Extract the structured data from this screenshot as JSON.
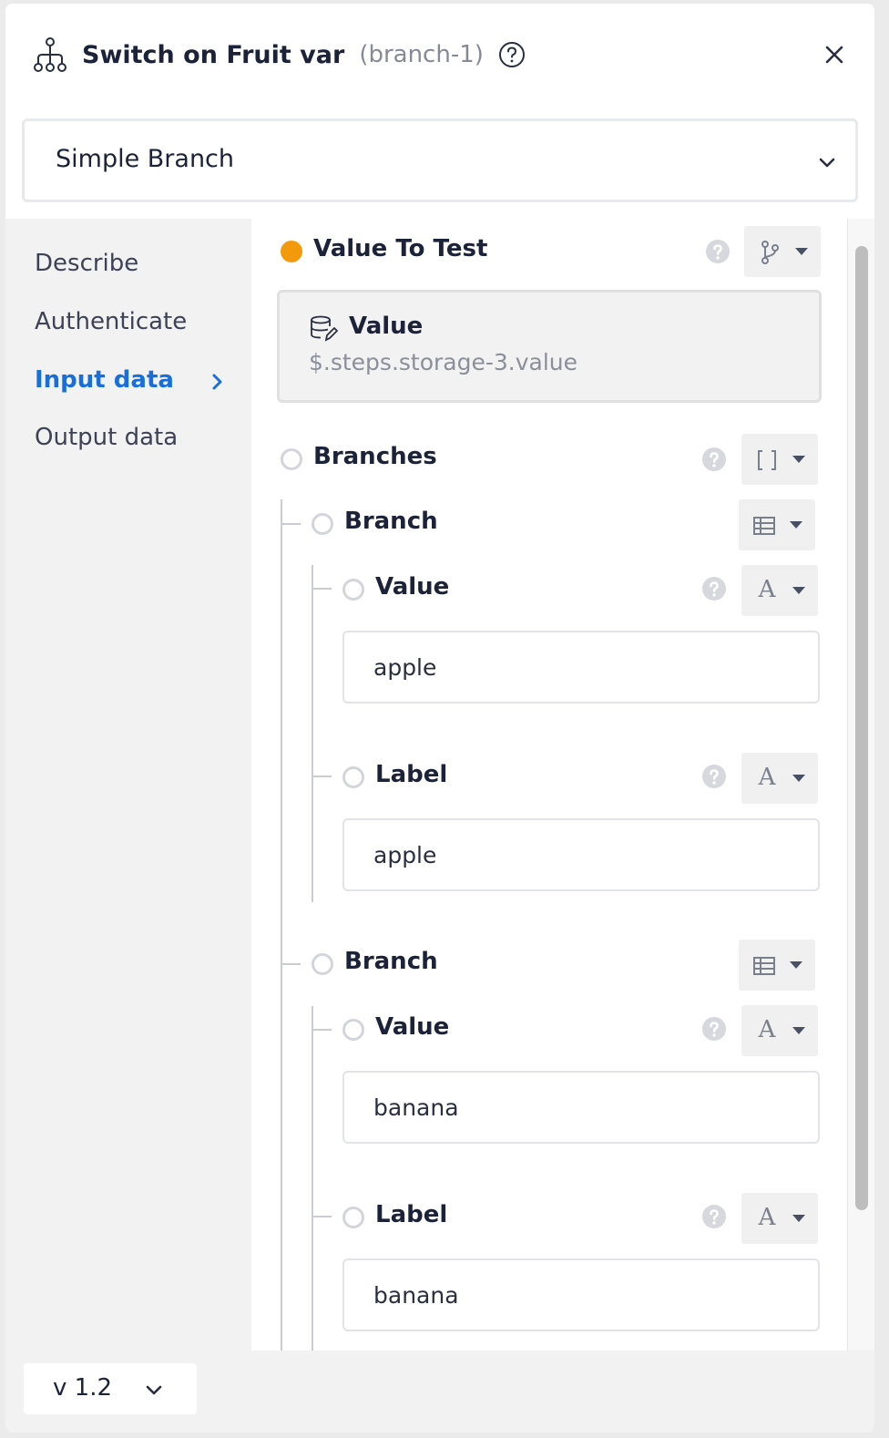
{
  "header": {
    "title": "Switch on Fruit var",
    "subtitle": "(branch-1)",
    "icons": {
      "app": "branch-tree-icon",
      "help": "help-circle-icon",
      "close": "close-icon"
    }
  },
  "action_select": {
    "value": "Simple Branch"
  },
  "sidebar": {
    "items": [
      {
        "label": "Describe",
        "active": false
      },
      {
        "label": "Authenticate",
        "active": false
      },
      {
        "label": "Input data",
        "active": true
      },
      {
        "label": "Output data",
        "active": false
      }
    ]
  },
  "inputs": {
    "value_to_test": {
      "label": "Value To Test",
      "card_title": "Value",
      "card_path": "$.steps.storage-3.value"
    },
    "branches": {
      "label": "Branches",
      "items": [
        {
          "label": "Branch",
          "value_label": "Value",
          "value": "apple",
          "label_label": "Label",
          "label_value": "apple"
        },
        {
          "label": "Branch",
          "value_label": "Value",
          "value": "banana",
          "label_label": "Label",
          "label_value": "banana"
        }
      ]
    }
  },
  "type_glyph": "A",
  "footer": {
    "version": "v 1.2"
  },
  "colors": {
    "accent": "#1a6ed8",
    "required_dot": "#f29a0c",
    "text": "#1c2237"
  }
}
